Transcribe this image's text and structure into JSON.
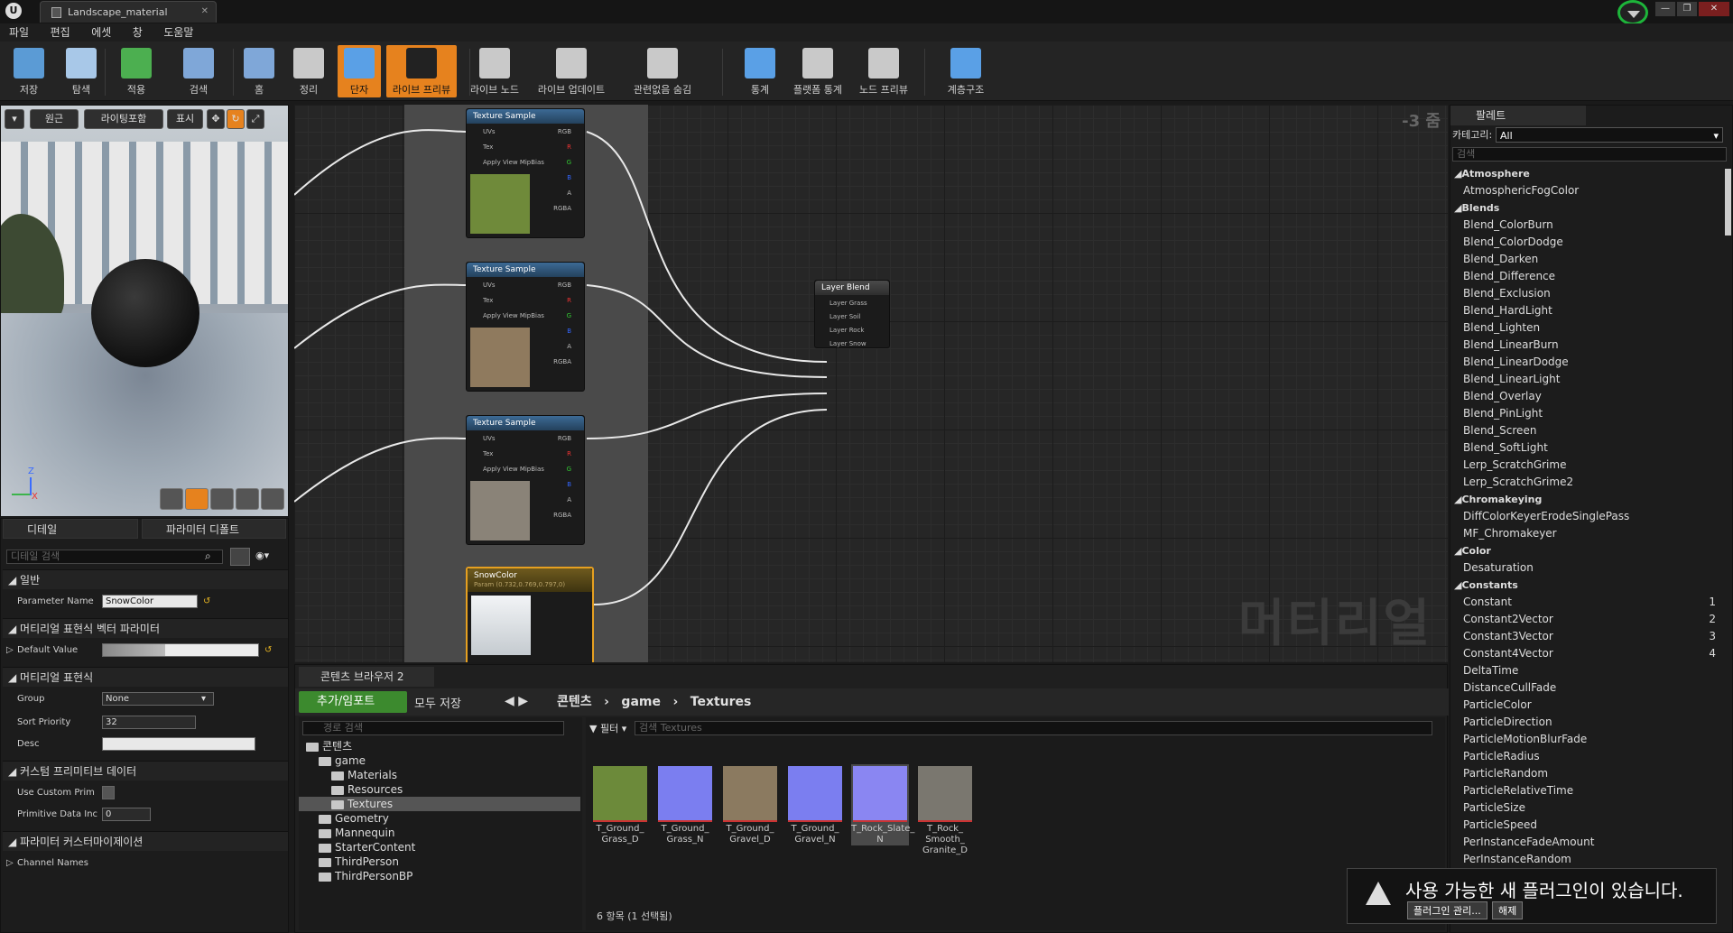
{
  "window": {
    "tab_title": "Landscape_material"
  },
  "menu": [
    "파일",
    "편집",
    "에셋",
    "창",
    "도움말"
  ],
  "toolbar": [
    {
      "label": "저장",
      "icon": "save-icon",
      "color": "#5b9bd5"
    },
    {
      "label": "탐색",
      "icon": "browse-icon",
      "color": "#a8c8e8"
    },
    {
      "label": "적용",
      "icon": "apply-check-icon",
      "color": "#4caf50"
    },
    {
      "label": "검색",
      "icon": "search-icon",
      "color": "#7fa7d8"
    },
    {
      "label": "홈",
      "icon": "home-icon",
      "color": "#7fa7d8"
    },
    {
      "label": "정리",
      "icon": "cleanup-icon",
      "color": "#c9c9c9"
    },
    {
      "label": "단자",
      "icon": "connectors-icon",
      "color": "#5aa0e6"
    },
    {
      "label": "라이브 프리뷰",
      "icon": "live-preview-icon",
      "color": "#222"
    },
    {
      "label": "라이브 노드",
      "icon": "live-nodes-icon",
      "color": "#c9c9c9"
    },
    {
      "label": "라이브 업데이트",
      "icon": "live-update-icon",
      "color": "#c9c9c9"
    },
    {
      "label": "관련없음 숨김",
      "icon": "hide-unrelated-icon",
      "color": "#c9c9c9"
    },
    {
      "label": "통계",
      "icon": "stats-icon",
      "color": "#5aa0e6"
    },
    {
      "label": "플랫폼 통계",
      "icon": "platform-stats-icon",
      "color": "#c9c9c9"
    },
    {
      "label": "노드 프리뷰",
      "icon": "node-preview-icon",
      "color": "#c9c9c9"
    },
    {
      "label": "계층구조",
      "icon": "hierarchy-icon",
      "color": "#5aa0e6"
    }
  ],
  "viewport": {
    "buttons": [
      "원근",
      "라이팅포함",
      "표시"
    ],
    "axis_z": "Z",
    "axis_x": "X"
  },
  "details": {
    "tab1": "디테일",
    "tab2": "파라미터 디폴트",
    "search_placeholder": "디테일 검색",
    "sec_general": "일반",
    "param_name_label": "Parameter Name",
    "param_name_value": "SnowColor",
    "sec_vector": "머티리얼 표현식 벡터 파라미터",
    "default_value_label": "Default Value",
    "sec_expr": "머티리얼 표현식",
    "group_label": "Group",
    "group_value": "None",
    "sort_label": "Sort Priority",
    "sort_value": "32",
    "desc_label": "Desc",
    "sec_custom": "커스텀 프리미티브 데이터",
    "use_custom_label": "Use Custom Prim",
    "prim_index_label": "Primitive Data Inc",
    "prim_index_value": "0",
    "sec_param_custom": "파라미터 커스터마이제이션",
    "channel_names_label": "Channel Names"
  },
  "graph": {
    "zoom": "-3 줌",
    "watermark": "머티리얼",
    "texture_node_title": "Texture Sample",
    "pins_in": [
      "UVs",
      "Tex",
      "Apply View MipBias"
    ],
    "pins_out": [
      "RGB",
      "R",
      "G",
      "B",
      "A",
      "RGBA"
    ],
    "texture_colors": [
      "#6f8a3a",
      "#8f7a5e",
      "#8a8378"
    ],
    "snow_title": "SnowColor",
    "snow_sub": "Param (0.732,0.769,0.797,0)",
    "blend_title": "Layer Blend",
    "blend_pins": [
      "Layer Grass",
      "Layer Soil",
      "Layer Rock",
      "Layer Snow"
    ]
  },
  "content_browser": {
    "tab": "콘텐츠 브라우저 2",
    "add_button": "추가/임포트",
    "save_all": "모두 저장",
    "breadcrumb": [
      "콘텐츠",
      "game",
      "Textures"
    ],
    "path_search_placeholder": "경로 검색",
    "filter_label": "필터",
    "asset_search_placeholder": "검색 Textures",
    "tree": [
      {
        "label": "콘텐츠",
        "depth": 0,
        "selected": false
      },
      {
        "label": "game",
        "depth": 1,
        "selected": false
      },
      {
        "label": "Materials",
        "depth": 2,
        "selected": false
      },
      {
        "label": "Resources",
        "depth": 2,
        "selected": false
      },
      {
        "label": "Textures",
        "depth": 2,
        "selected": true
      },
      {
        "label": "Geometry",
        "depth": 1,
        "selected": false
      },
      {
        "label": "Mannequin",
        "depth": 1,
        "selected": false
      },
      {
        "label": "StarterContent",
        "depth": 1,
        "selected": false
      },
      {
        "label": "ThirdPerson",
        "depth": 1,
        "selected": false
      },
      {
        "label": "ThirdPersonBP",
        "depth": 1,
        "selected": false
      }
    ],
    "assets": [
      {
        "name": "T_Ground_ Grass_D",
        "color": "#6c8a3a",
        "selected": false
      },
      {
        "name": "T_Ground_ Grass_N",
        "color": "#7b7ef0",
        "selected": false
      },
      {
        "name": "T_Ground_ Gravel_D",
        "color": "#8b7a60",
        "selected": false
      },
      {
        "name": "T_Ground_ Gravel_N",
        "color": "#7b7ef0",
        "selected": false
      },
      {
        "name": "T_Rock_Slate_ N",
        "color": "#8a86f2",
        "selected": true
      },
      {
        "name": "T_Rock_ Smooth_ Granite_D",
        "color": "#7a776f",
        "selected": false
      }
    ],
    "status": "6 항목 (1 선택됨)"
  },
  "palette": {
    "tab": "팔레트",
    "category_label": "카테고리:",
    "category_value": "All",
    "search_placeholder": "검색",
    "items": [
      {
        "label": "Atmosphere",
        "header": true,
        "num": ""
      },
      {
        "label": "AtmosphericFogColor",
        "header": false,
        "num": ""
      },
      {
        "label": "Blends",
        "header": true,
        "num": ""
      },
      {
        "label": "Blend_ColorBurn",
        "header": false,
        "num": ""
      },
      {
        "label": "Blend_ColorDodge",
        "header": false,
        "num": ""
      },
      {
        "label": "Blend_Darken",
        "header": false,
        "num": ""
      },
      {
        "label": "Blend_Difference",
        "header": false,
        "num": ""
      },
      {
        "label": "Blend_Exclusion",
        "header": false,
        "num": ""
      },
      {
        "label": "Blend_HardLight",
        "header": false,
        "num": ""
      },
      {
        "label": "Blend_Lighten",
        "header": false,
        "num": ""
      },
      {
        "label": "Blend_LinearBurn",
        "header": false,
        "num": ""
      },
      {
        "label": "Blend_LinearDodge",
        "header": false,
        "num": ""
      },
      {
        "label": "Blend_LinearLight",
        "header": false,
        "num": ""
      },
      {
        "label": "Blend_Overlay",
        "header": false,
        "num": ""
      },
      {
        "label": "Blend_PinLight",
        "header": false,
        "num": ""
      },
      {
        "label": "Blend_Screen",
        "header": false,
        "num": ""
      },
      {
        "label": "Blend_SoftLight",
        "header": false,
        "num": ""
      },
      {
        "label": "Lerp_ScratchGrime",
        "header": false,
        "num": ""
      },
      {
        "label": "Lerp_ScratchGrime2",
        "header": false,
        "num": ""
      },
      {
        "label": "Chromakeying",
        "header": true,
        "num": ""
      },
      {
        "label": "DiffColorKeyerErodeSinglePass",
        "header": false,
        "num": ""
      },
      {
        "label": "MF_Chromakeyer",
        "header": false,
        "num": ""
      },
      {
        "label": "Color",
        "header": true,
        "num": ""
      },
      {
        "label": "Desaturation",
        "header": false,
        "num": ""
      },
      {
        "label": "Constants",
        "header": true,
        "num": ""
      },
      {
        "label": "Constant",
        "header": false,
        "num": "1"
      },
      {
        "label": "Constant2Vector",
        "header": false,
        "num": "2"
      },
      {
        "label": "Constant3Vector",
        "header": false,
        "num": "3"
      },
      {
        "label": "Constant4Vector",
        "header": false,
        "num": "4"
      },
      {
        "label": "DeltaTime",
        "header": false,
        "num": ""
      },
      {
        "label": "DistanceCullFade",
        "header": false,
        "num": ""
      },
      {
        "label": "ParticleColor",
        "header": false,
        "num": ""
      },
      {
        "label": "ParticleDirection",
        "header": false,
        "num": ""
      },
      {
        "label": "ParticleMotionBlurFade",
        "header": false,
        "num": ""
      },
      {
        "label": "ParticleRadius",
        "header": false,
        "num": ""
      },
      {
        "label": "ParticleRandom",
        "header": false,
        "num": ""
      },
      {
        "label": "ParticleRelativeTime",
        "header": false,
        "num": ""
      },
      {
        "label": "ParticleSize",
        "header": false,
        "num": ""
      },
      {
        "label": "ParticleSpeed",
        "header": false,
        "num": ""
      },
      {
        "label": "PerInstanceFadeAmount",
        "header": false,
        "num": ""
      },
      {
        "label": "PerInstanceRandom",
        "header": false,
        "num": ""
      }
    ]
  },
  "toast": {
    "message": "사용 가능한 새 플러그인이 있습니다.",
    "manage_button": "플러그인 관리...",
    "dismiss_button": "해제"
  }
}
